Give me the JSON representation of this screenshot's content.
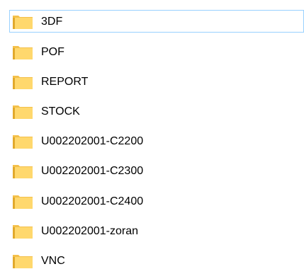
{
  "folders": [
    {
      "name": "3DF",
      "focused": true
    },
    {
      "name": "POF",
      "focused": false
    },
    {
      "name": "REPORT",
      "focused": false
    },
    {
      "name": "STOCK",
      "focused": false
    },
    {
      "name": "U002202001-C2200",
      "focused": false
    },
    {
      "name": "U002202001-C2300",
      "focused": false
    },
    {
      "name": "U002202001-C2400",
      "focused": false
    },
    {
      "name": "U002202001-zoran",
      "focused": false
    },
    {
      "name": "VNC",
      "focused": false
    }
  ],
  "colors": {
    "folder_body": "#ffd86d",
    "folder_edge": "#e1a92c",
    "focus_border": "#99d1ff",
    "text": "#000000"
  },
  "icon": "folder-icon"
}
